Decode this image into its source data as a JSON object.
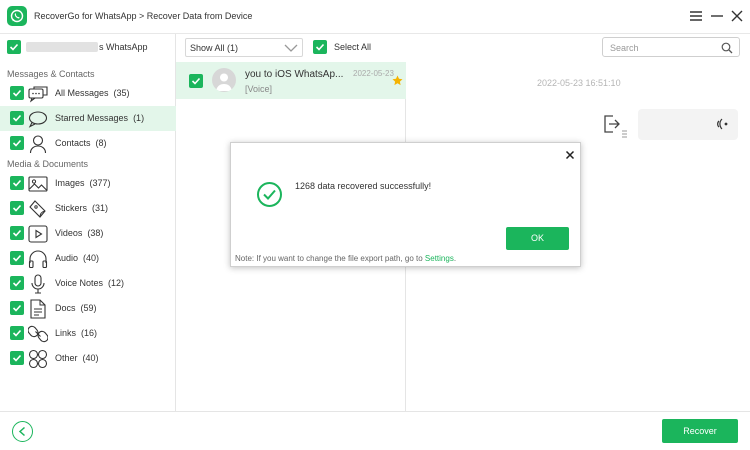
{
  "window": {
    "title": "RecoverGo for WhatsApp > Recover Data from Device",
    "accent_color": "#1bb55c",
    "selected_bg": "#e3f6ea"
  },
  "sidebar": {
    "account_label": "s WhatsApp",
    "sections": [
      {
        "title": "Messages & Contacts",
        "items": [
          {
            "label": "All Messages",
            "count": "(35)",
            "icon": "chat-bubbles-icon",
            "active": false
          },
          {
            "label": "Starred Messages",
            "count": "(1)",
            "icon": "starred-bubble-icon",
            "active": true
          },
          {
            "label": "Contacts",
            "count": "(8)",
            "icon": "person-icon",
            "active": false
          }
        ]
      },
      {
        "title": "Media & Documents",
        "items": [
          {
            "label": "Images",
            "count": "(377)",
            "icon": "image-icon",
            "active": false
          },
          {
            "label": "Stickers",
            "count": "(31)",
            "icon": "sticker-icon",
            "active": false
          },
          {
            "label": "Videos",
            "count": "(38)",
            "icon": "video-icon",
            "active": false
          },
          {
            "label": "Audio",
            "count": "(40)",
            "icon": "headphones-icon",
            "active": false
          },
          {
            "label": "Voice Notes",
            "count": "(12)",
            "icon": "microphone-icon",
            "active": false
          },
          {
            "label": "Docs",
            "count": "(59)",
            "icon": "document-icon",
            "active": false
          },
          {
            "label": "Links",
            "count": "(16)",
            "icon": "link-icon",
            "active": false
          },
          {
            "label": "Other",
            "count": "(40)",
            "icon": "grid-icon",
            "active": false
          }
        ]
      }
    ]
  },
  "toolbar": {
    "filter_value": "Show All (1)",
    "select_all_label": "Select All",
    "search_placeholder": "Search"
  },
  "message_list": {
    "items": [
      {
        "title": "you to iOS WhatsAp...",
        "date": "2022-05-23",
        "subtitle": "[Voice]",
        "starred": true
      }
    ]
  },
  "detail": {
    "timestamp": "2022-05-23 16:51:10"
  },
  "dialog": {
    "message": "1268 data recovered successfully!",
    "ok_label": "OK",
    "note_prefix": "Note: If you want to change the file export path, go to ",
    "note_link": "Settings",
    "note_suffix": "."
  },
  "footer": {
    "recover_label": "Recover"
  }
}
